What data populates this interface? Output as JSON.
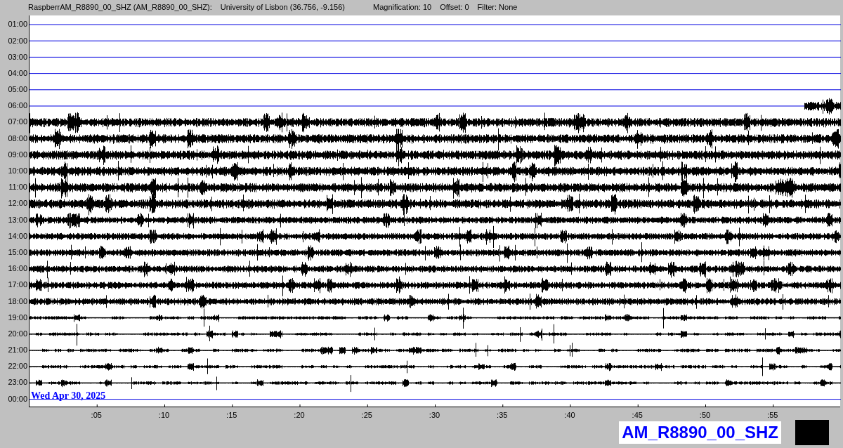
{
  "header": {
    "station": "RaspberrAM_R8890_00_SHZ (AM_R8890_00_SHZ):",
    "location": "University of Lisbon (36.756, -9.156)",
    "magnification": "Magnification: 10",
    "offset": "Offset: 0",
    "filter": "Filter: None"
  },
  "rows": [
    {
      "label": "01:00",
      "kind": "empty"
    },
    {
      "label": "02:00",
      "kind": "empty"
    },
    {
      "label": "03:00",
      "kind": "empty"
    },
    {
      "label": "04:00",
      "kind": "empty"
    },
    {
      "label": "05:00",
      "kind": "empty"
    },
    {
      "label": "06:00",
      "kind": "partial"
    },
    {
      "label": "07:00",
      "kind": "full"
    },
    {
      "label": "08:00",
      "kind": "full"
    },
    {
      "label": "09:00",
      "kind": "full"
    },
    {
      "label": "10:00",
      "kind": "full"
    },
    {
      "label": "11:00",
      "kind": "full"
    },
    {
      "label": "12:00",
      "kind": "full"
    },
    {
      "label": "13:00",
      "kind": "full"
    },
    {
      "label": "14:00",
      "kind": "full"
    },
    {
      "label": "15:00",
      "kind": "full"
    },
    {
      "label": "16:00",
      "kind": "full"
    },
    {
      "label": "17:00",
      "kind": "full"
    },
    {
      "label": "18:00",
      "kind": "full"
    },
    {
      "label": "19:00",
      "kind": "full"
    },
    {
      "label": "20:00",
      "kind": "full"
    },
    {
      "label": "21:00",
      "kind": "full"
    },
    {
      "label": "22:00",
      "kind": "full"
    },
    {
      "label": "23:00",
      "kind": "full"
    },
    {
      "label": "00:00",
      "kind": "empty"
    }
  ],
  "date": "Wed Apr 30, 2025",
  "x_ticks": [
    ":05",
    ":10",
    ":15",
    ":20",
    ":25",
    ":30",
    ":35",
    ":40",
    ":45",
    ":50",
    ":55"
  ],
  "station_label": "AM_R8890_00_SHZ"
}
